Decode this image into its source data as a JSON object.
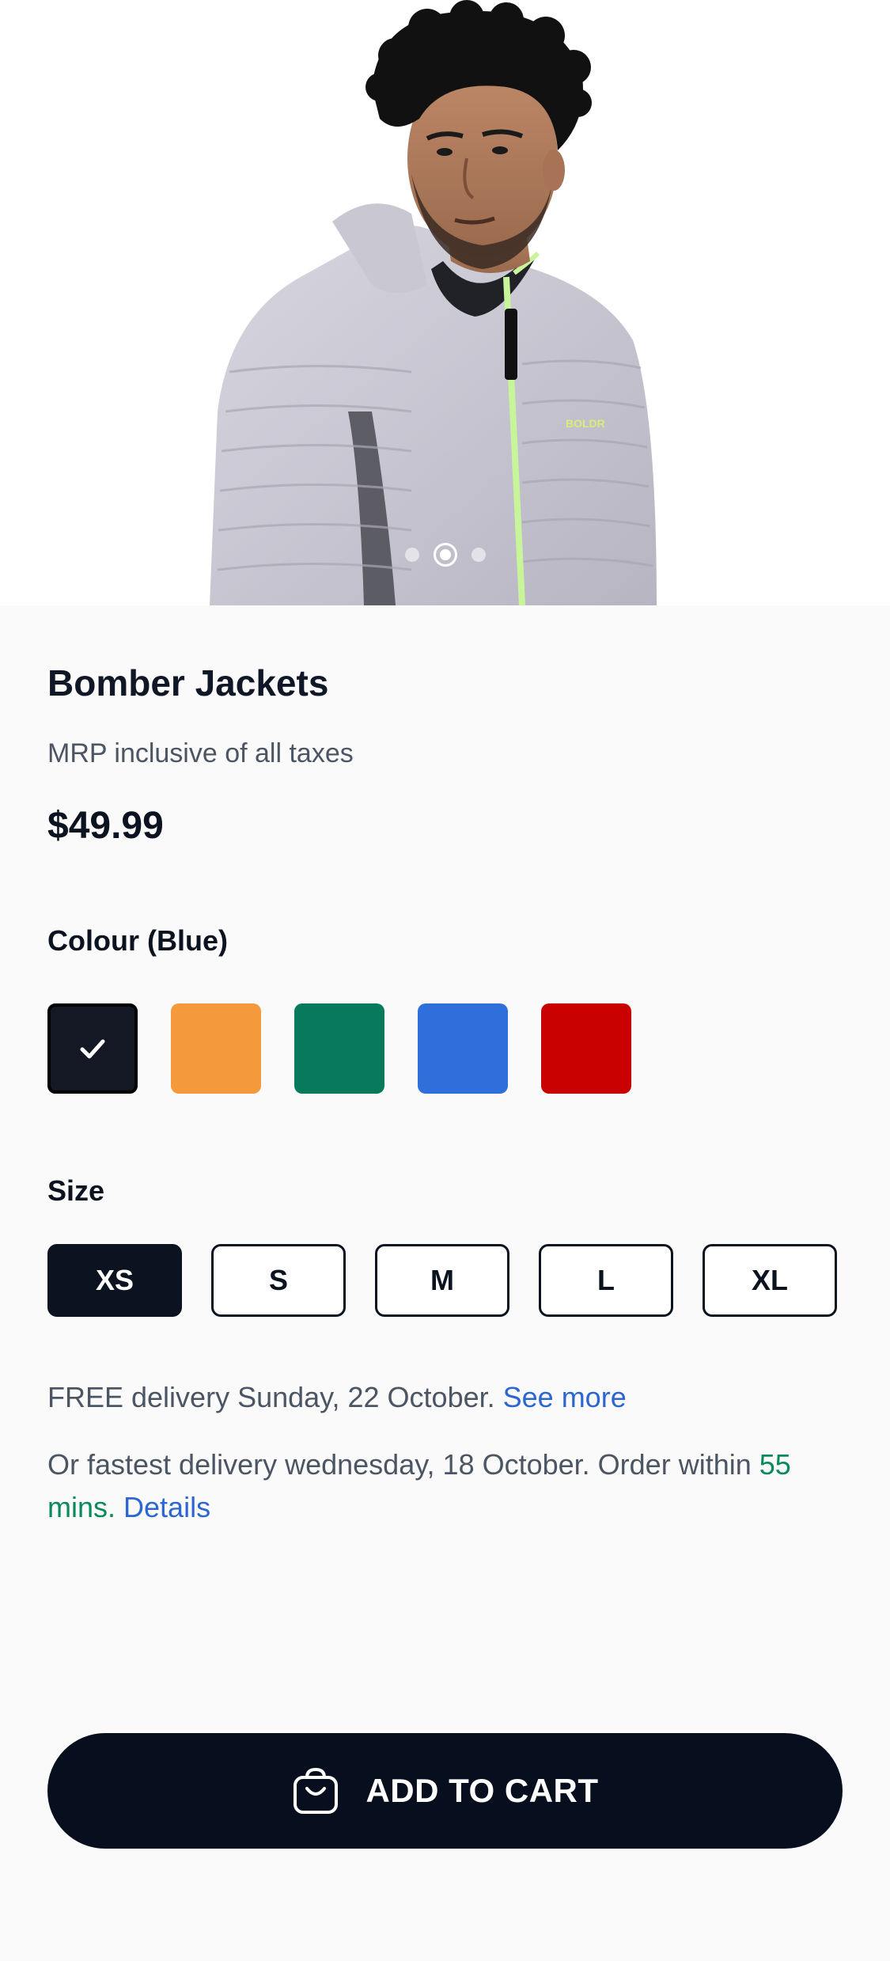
{
  "product": {
    "title": "Bomber Jackets",
    "mrp_note": "MRP inclusive of all taxes",
    "price": "$49.99",
    "image_alt": "product-photo-model-in-hooded-puffer-jacket",
    "carousel": {
      "count": 3,
      "active_index": 1
    }
  },
  "colour": {
    "label": "Colour (Blue)",
    "swatches": [
      {
        "name": "black",
        "hex": "#141824",
        "selected": true
      },
      {
        "name": "orange",
        "hex": "#f59a3c",
        "selected": false
      },
      {
        "name": "green",
        "hex": "#087a5b",
        "selected": false
      },
      {
        "name": "blue",
        "hex": "#2f6fdb",
        "selected": false
      },
      {
        "name": "red",
        "hex": "#c80000",
        "selected": false
      }
    ]
  },
  "size": {
    "label": "Size",
    "options": [
      "XS",
      "S",
      "M",
      "L",
      "XL"
    ],
    "selected": "XS"
  },
  "delivery": {
    "free_text": "FREE delivery Sunday, 22 October.",
    "see_more": "See more",
    "fastest_text": "Or fastest delivery wednesday, 18 October. Order within",
    "time_left": "55 mins.",
    "details": "Details"
  },
  "cart": {
    "label": "ADD TO CART",
    "icon": "shopping-bag-icon"
  },
  "colors": {
    "primary": "#070f1f",
    "link": "#2b66d1",
    "success": "#0a8a5a"
  }
}
